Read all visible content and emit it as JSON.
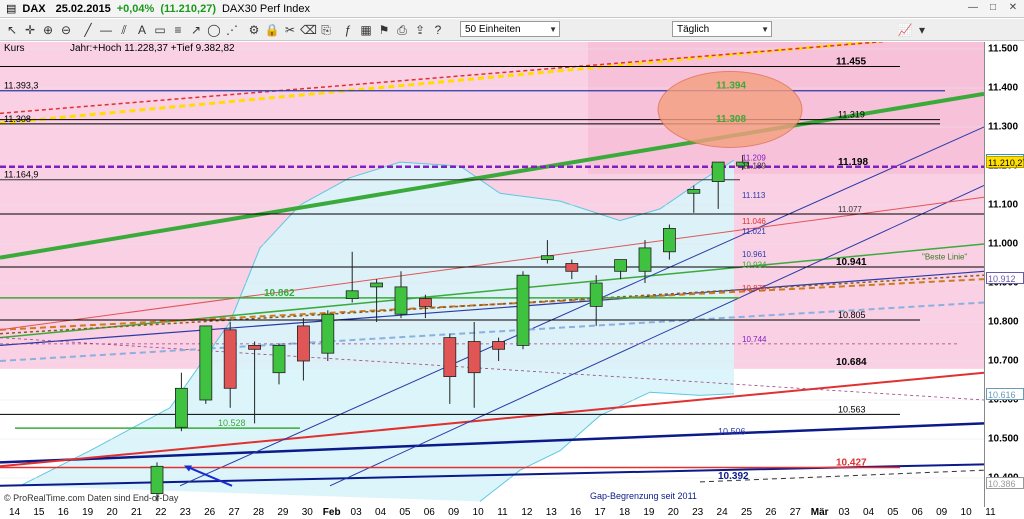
{
  "title_bar": {
    "symbol": "DAX",
    "date": "25.02.2015",
    "change": "+0,04%",
    "price": "(11.210,27)",
    "name": "DAX30 Perf Index"
  },
  "toolbar": {
    "units_select": "50 Einheiten",
    "period_select": "Täglich"
  },
  "info_bar": {
    "kurs_label": "Kurs",
    "summary": "Jahr:+Hoch 11.228,37 +Tief 9.382,82"
  },
  "footer": {
    "copyright": "© ProRealTime.com  Daten sind End-of-Day",
    "gap_label": "Gap-Begrenzung seit 2011"
  },
  "chart_data": {
    "type": "candlestick",
    "x_ticks": [
      "14",
      "15",
      "16",
      "19",
      "20",
      "21",
      "22",
      "23",
      "26",
      "27",
      "28",
      "29",
      "30",
      "Feb",
      "03",
      "04",
      "05",
      "06",
      "09",
      "10",
      "11",
      "12",
      "13",
      "16",
      "17",
      "18",
      "19",
      "20",
      "23",
      "24",
      "25",
      "26",
      "27",
      "Mär",
      "03",
      "04",
      "05",
      "06",
      "09",
      "10",
      "11"
    ],
    "y_ticks": [
      10400,
      10500,
      10600,
      10700,
      10800,
      10900,
      11000,
      11100,
      11200,
      11300,
      11400,
      11500
    ],
    "y_tick_labels": [
      "10.400",
      "10.500",
      "10.600",
      "10.700",
      "10.800",
      "10.900",
      "11.000",
      "11.100",
      "11.200",
      "11.300",
      "11.400",
      "11.500"
    ],
    "ylim": [
      10365,
      11530
    ],
    "candles": [
      {
        "o": 10360,
        "h": 10440,
        "l": 10340,
        "c": 10430
      },
      {
        "o": 10530,
        "h": 10670,
        "l": 10520,
        "c": 10630
      },
      {
        "o": 10600,
        "h": 10790,
        "l": 10590,
        "c": 10790
      },
      {
        "o": 10780,
        "h": 10800,
        "l": 10580,
        "c": 10630
      },
      {
        "o": 10740,
        "h": 10750,
        "l": 10540,
        "c": 10730
      },
      {
        "o": 10670,
        "h": 10745,
        "l": 10640,
        "c": 10740
      },
      {
        "o": 10790,
        "h": 10810,
        "l": 10650,
        "c": 10700
      },
      {
        "o": 10720,
        "h": 10830,
        "l": 10700,
        "c": 10820
      },
      {
        "o": 10860,
        "h": 10980,
        "l": 10850,
        "c": 10880
      },
      {
        "o": 10890,
        "h": 10910,
        "l": 10800,
        "c": 10900
      },
      {
        "o": 10820,
        "h": 10930,
        "l": 10810,
        "c": 10890
      },
      {
        "o": 10860,
        "h": 10870,
        "l": 10810,
        "c": 10840
      },
      {
        "o": 10760,
        "h": 10770,
        "l": 10590,
        "c": 10660
      },
      {
        "o": 10750,
        "h": 10800,
        "l": 10580,
        "c": 10670
      },
      {
        "o": 10750,
        "h": 10760,
        "l": 10700,
        "c": 10730
      },
      {
        "o": 10740,
        "h": 10930,
        "l": 10730,
        "c": 10920
      },
      {
        "o": 10960,
        "h": 11010,
        "l": 10950,
        "c": 10970
      },
      {
        "o": 10950,
        "h": 10960,
        "l": 10910,
        "c": 10930
      },
      {
        "o": 10840,
        "h": 10920,
        "l": 10790,
        "c": 10900
      },
      {
        "o": 10930,
        "h": 10960,
        "l": 10910,
        "c": 10960
      },
      {
        "o": 10930,
        "h": 11010,
        "l": 10900,
        "c": 10990
      },
      {
        "o": 10980,
        "h": 11050,
        "l": 10960,
        "c": 11040
      },
      {
        "o": 11130,
        "h": 11150,
        "l": 11080,
        "c": 11140
      },
      {
        "o": 11160,
        "h": 11210,
        "l": 11090,
        "c": 11210
      },
      {
        "o": 11200,
        "h": 11228,
        "l": 11190,
        "c": 11210
      }
    ],
    "horizontal_levels": [
      {
        "value": 11455,
        "label": "11.455"
      },
      {
        "value": 11394,
        "label": "11.394"
      },
      {
        "value": 11393,
        "label": "11.393,3"
      },
      {
        "value": 11319,
        "label": "11.319"
      },
      {
        "value": 11308,
        "label": "11.308"
      },
      {
        "value": 11209,
        "label": "11.209"
      },
      {
        "value": 11198,
        "label": "11.198"
      },
      {
        "value": 11189,
        "label": "11.189"
      },
      {
        "value": 11164.9,
        "label": "11.164,9"
      },
      {
        "value": 11113,
        "label": "11.113"
      },
      {
        "value": 11077,
        "label": "11.077"
      },
      {
        "value": 11046,
        "label": "11.046"
      },
      {
        "value": 11021,
        "label": "11.021"
      },
      {
        "value": 10961,
        "label": "10.961"
      },
      {
        "value": 10941,
        "label": "10.941"
      },
      {
        "value": 10934,
        "label": "10.934"
      },
      {
        "value": 10875,
        "label": "10.875"
      },
      {
        "value": 10862,
        "label": "10.862"
      },
      {
        "value": 10805,
        "label": "10.805"
      },
      {
        "value": 10744,
        "label": "10.744"
      },
      {
        "value": 10684,
        "label": "10.684"
      },
      {
        "value": 10563,
        "label": "10.563"
      },
      {
        "value": 10528,
        "label": "10.528"
      },
      {
        "value": 10506,
        "label": "10.506"
      },
      {
        "value": 10427,
        "label": "10.427"
      },
      {
        "value": 10392,
        "label": "10.392"
      }
    ],
    "annotations": [
      "Beste Linie"
    ],
    "right_price_boxes": [
      {
        "value": 11215,
        "label": "11.215",
        "color": "#2a9aa8"
      },
      {
        "value": 11210.27,
        "label": "11.210,27",
        "color": "#b7a000"
      },
      {
        "value": 10912,
        "label": "10.912",
        "color": "#6a5aaa"
      },
      {
        "value": 10616,
        "label": "10.616",
        "color": "#6a9ab8"
      },
      {
        "value": 10386,
        "label": "10.386",
        "color": "#999999"
      }
    ],
    "colors": {
      "up": "#3fc23f",
      "down": "#e05555",
      "pink_zone": "#fad0e4",
      "bollinger": "#5ec7e0",
      "cyan_fill": "#d8f4fa"
    }
  }
}
